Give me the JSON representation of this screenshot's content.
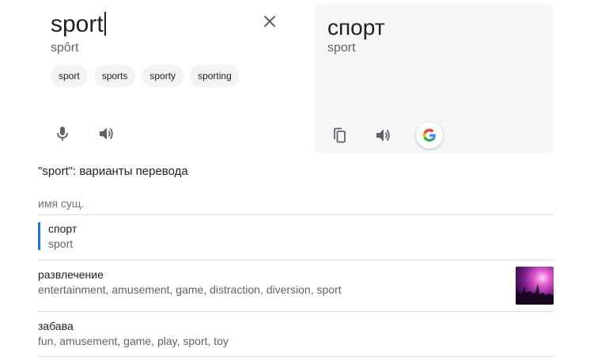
{
  "source": {
    "text": "sport",
    "transliteration": "spôrt",
    "suggestions": [
      "sport",
      "sports",
      "sporty",
      "sporting"
    ],
    "icons": {
      "clear": "close-icon",
      "mic": "microphone-icon",
      "listen": "speaker-icon"
    }
  },
  "target": {
    "text": "спорт",
    "transliteration": "sport",
    "icons": {
      "copy": "copy-icon",
      "listen": "speaker-icon",
      "google": "google-g-icon"
    },
    "panel_color": "#f5f6f7"
  },
  "dictionary": {
    "title": "\"sport\": варианты перевода",
    "part_of_speech": "имя сущ.",
    "entries": [
      {
        "word": "спорт",
        "synonyms": "sport",
        "selected": true
      },
      {
        "word": "развлечение",
        "synonyms": "entertainment, amusement, game, distraction, diversion, sport",
        "has_image": true
      },
      {
        "word": "забава",
        "synonyms": "fun, amusement, game, play, sport, toy"
      }
    ]
  },
  "colors": {
    "accent": "#1a73e8",
    "chip_bg": "#f1f3f4",
    "divider": "#dadce0"
  }
}
